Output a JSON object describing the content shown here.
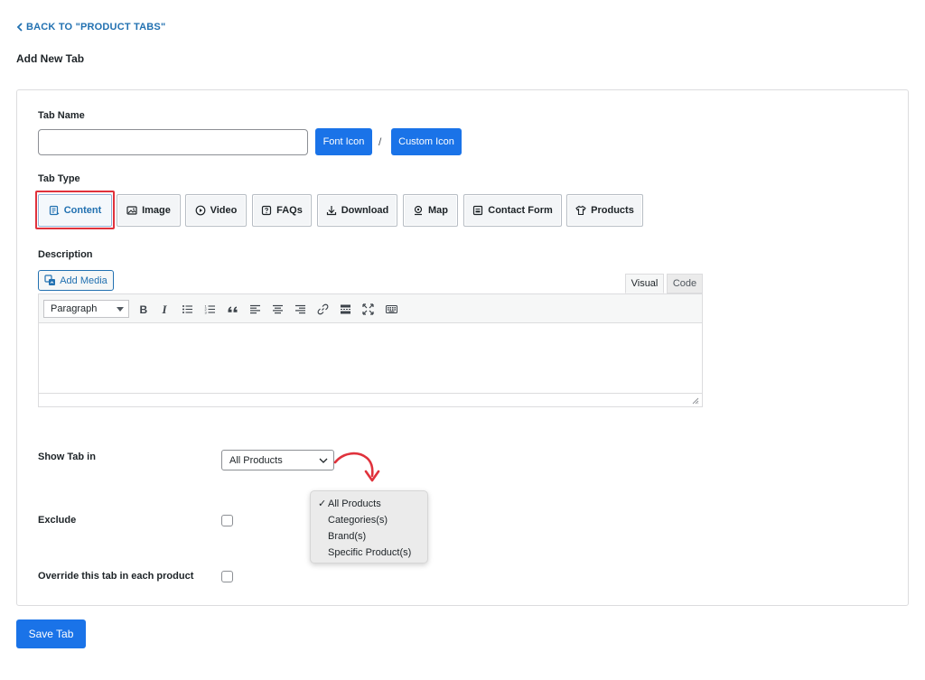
{
  "nav": {
    "back_label": "BACK TO \"PRODUCT TABS\""
  },
  "page": {
    "title": "Add New Tab"
  },
  "tab_name": {
    "label": "Tab Name",
    "value": "",
    "placeholder": "",
    "font_icon_label": "Font Icon",
    "separator": "/",
    "custom_icon_label": "Custom Icon"
  },
  "tab_type": {
    "label": "Tab Type",
    "selected": "Content",
    "items": [
      {
        "label": "Content",
        "icon": "content-icon"
      },
      {
        "label": "Image",
        "icon": "image-icon"
      },
      {
        "label": "Video",
        "icon": "play-icon"
      },
      {
        "label": "FAQs",
        "icon": "question-icon"
      },
      {
        "label": "Download",
        "icon": "download-icon"
      },
      {
        "label": "Map",
        "icon": "map-pin-icon"
      },
      {
        "label": "Contact Form",
        "icon": "form-icon"
      },
      {
        "label": "Products",
        "icon": "shirt-icon"
      }
    ]
  },
  "description": {
    "label": "Description",
    "add_media_label": "Add Media",
    "visual_tab": "Visual",
    "code_tab": "Code",
    "format_value": "Paragraph",
    "content": ""
  },
  "show_tab_in": {
    "label": "Show Tab in",
    "selected": "All Products",
    "options": [
      "All Products",
      "Categories(s)",
      "Brand(s)",
      "Specific Product(s)"
    ]
  },
  "exclude": {
    "label": "Exclude",
    "checked": false
  },
  "override": {
    "label": "Override this tab in each product",
    "checked": false
  },
  "actions": {
    "save_label": "Save Tab"
  },
  "colors": {
    "primary": "#1a73e8",
    "link": "#2271b1",
    "highlight": "#e0323c"
  }
}
